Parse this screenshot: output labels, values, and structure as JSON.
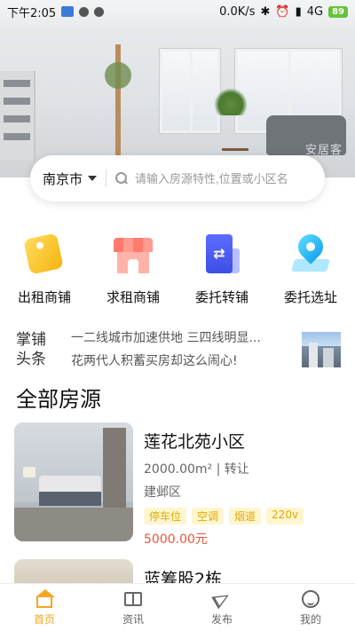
{
  "status_bar": {
    "time": "下午2:05",
    "speed": "0.0K/s",
    "network": "4G",
    "battery": "89"
  },
  "hero": {
    "watermark": "安居客"
  },
  "search": {
    "city": "南京市",
    "placeholder": "请输入房源特性,位置或小区名"
  },
  "actions": [
    {
      "label": "出租商铺",
      "icon": "price-tag-icon"
    },
    {
      "label": "求租商铺",
      "icon": "storefront-icon"
    },
    {
      "label": "委托转铺",
      "icon": "transfer-document-icon"
    },
    {
      "label": "委托选址",
      "icon": "location-pin-icon"
    }
  ],
  "news": {
    "logo_line1": "掌铺",
    "logo_line2": "头条",
    "line1": "一二线城市加速供地 三四线明显...",
    "line2": "花两代人积蓄买房却这么闹心!"
  },
  "section_title": "全部房源",
  "listings": [
    {
      "name": "莲花北苑小区",
      "meta": "2000.00m² | 转让",
      "district": "建邺区",
      "tags": [
        "停车位",
        "空调",
        "烟道",
        "220v"
      ],
      "price": "5000.00元"
    },
    {
      "name": "蓝筹股2栋"
    }
  ],
  "tabbar": [
    {
      "label": "首页",
      "icon": "home-icon",
      "active": true
    },
    {
      "label": "资讯",
      "icon": "book-icon"
    },
    {
      "label": "发布",
      "icon": "send-icon"
    },
    {
      "label": "我的",
      "icon": "smiley-icon"
    }
  ],
  "colors": {
    "accent": "#f5a623",
    "price": "#e8553a",
    "tag_text": "#e6a800",
    "tag_bg": "#fff6cf"
  }
}
